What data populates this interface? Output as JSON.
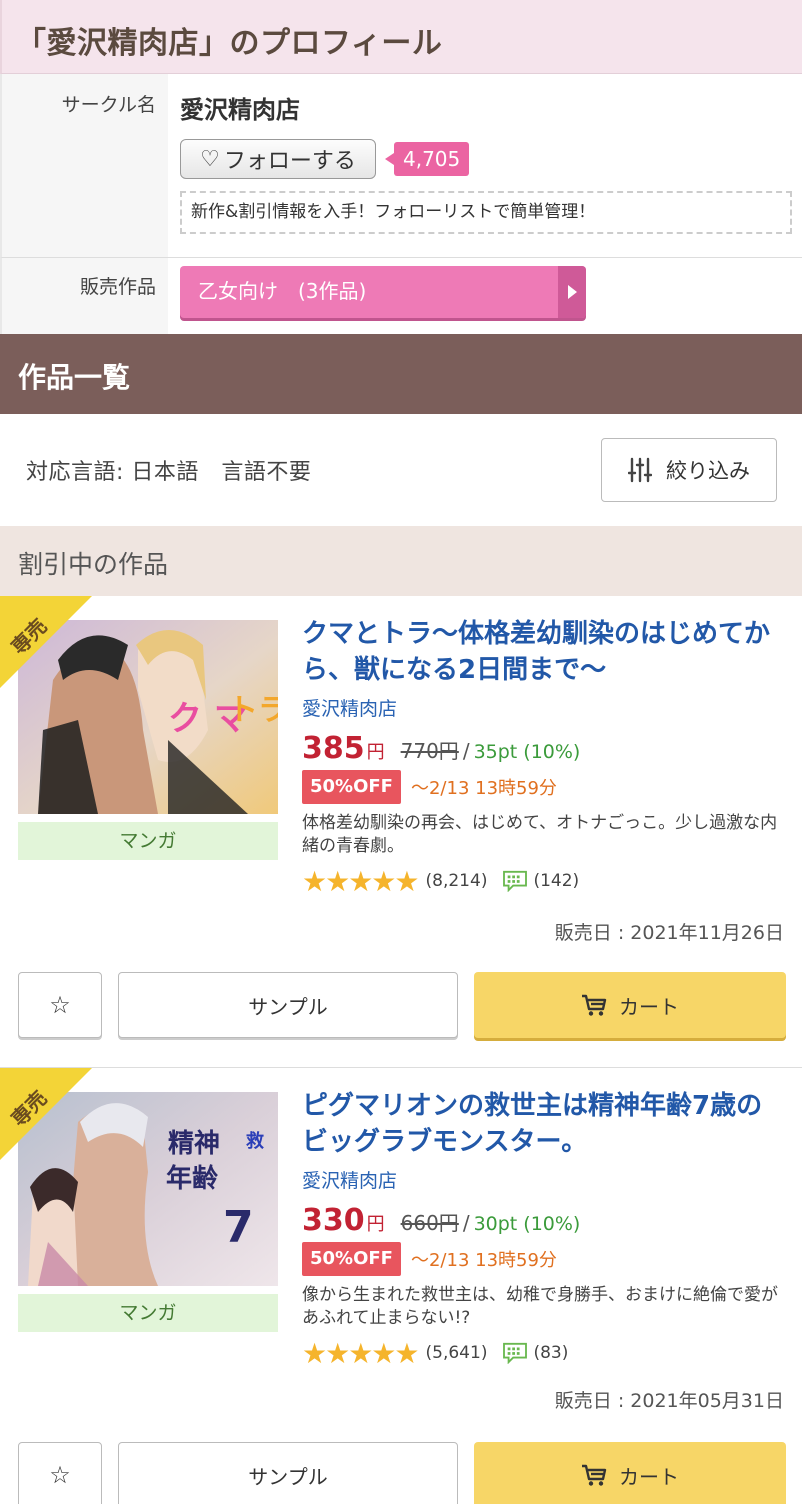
{
  "profile": {
    "title": "「愛沢精肉店」のプロフィール",
    "circle_label": "サークル名",
    "circle_name": "愛沢精肉店",
    "follow_label": "フォローする",
    "follow_count": "4,705",
    "follow_note": "新作&割引情報を入手！フォローリストで簡単管理！",
    "works_label": "販売作品",
    "works_button": "乙女向け　(3作品)"
  },
  "list": {
    "header": "作品一覧",
    "languages": "対応言語: 日本語　言語不要",
    "filter_label": "絞り込み",
    "sale_header": "割引中の作品"
  },
  "products": [
    {
      "badge": "専売",
      "genre": "マンガ",
      "title": "クマとトラ〜体格差幼馴染のはじめてから、獣になる2日間まで〜",
      "maker": "愛沢精肉店",
      "price": "385",
      "yen": "円",
      "old_price": "770円",
      "slash": "/",
      "points": "35pt (10%)",
      "off": "50%OFF",
      "deadline": "〜2/13 13時59分",
      "description": "体格差幼馴染の再会、はじめて、オトナごっこ。少し過激な内緒の青春劇。",
      "stars": "★★★★★",
      "rating_count": "(8,214)",
      "comment_count": "(142)",
      "date": "販売日 : 2021年11月26日",
      "sample_label": "サンプル",
      "cart_label": "カート"
    },
    {
      "badge": "専売",
      "genre": "マンガ",
      "title": "ピグマリオンの救世主は精神年齢7歳のビッグラブモンスター。",
      "maker": "愛沢精肉店",
      "price": "330",
      "yen": "円",
      "old_price": "660円",
      "slash": "/",
      "points": "30pt (10%)",
      "off": "50%OFF",
      "deadline": "〜2/13 13時59分",
      "description": "像から生まれた救世主は、幼稚で身勝手、おまけに絶倫で愛があふれて止まらない!?",
      "stars": "★★★★★",
      "rating_count": "(5,641)",
      "comment_count": "(83)",
      "date": "販売日 : 2021年05月31日",
      "sample_label": "サンプル",
      "cart_label": "カート"
    }
  ],
  "colors": {
    "brand_header": "#7b5e5a",
    "pink": "#ee7ab6",
    "price_red": "#c22233",
    "link_blue": "#2258a8",
    "cart_yellow": "#f7d667",
    "star": "#f5b42c"
  }
}
